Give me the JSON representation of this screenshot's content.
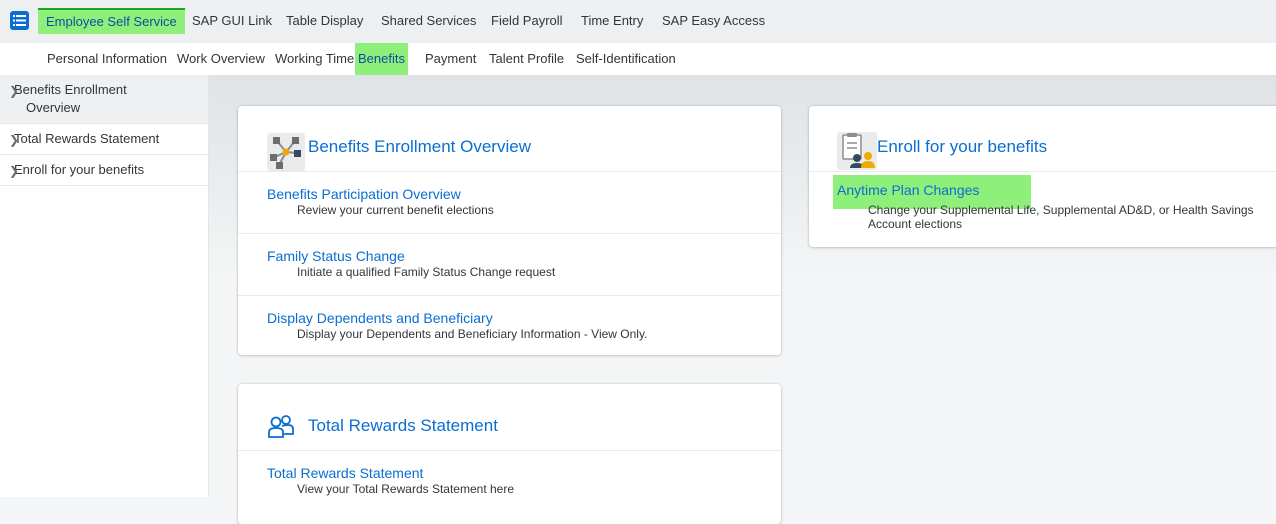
{
  "top_tabs": [
    "Employee Self Service",
    "SAP GUI Link",
    "Table Display",
    "Shared Services",
    "Field Payroll",
    "Time Entry",
    "SAP Easy Access"
  ],
  "sub_tabs": [
    "Personal Information",
    "Work Overview",
    "Working Time",
    "Benefits",
    "Payment",
    "Talent Profile",
    "Self-Identification"
  ],
  "sidebar": {
    "items": [
      {
        "label_line1": "Benefits Enrollment",
        "label_line2": "Overview"
      },
      {
        "label": "Total Rewards Statement"
      },
      {
        "label": "Enroll for your benefits"
      }
    ]
  },
  "cards": {
    "benefits_overview": {
      "title": "Benefits Enrollment Overview",
      "links": [
        {
          "title": "Benefits Participation Overview",
          "desc": "Review your current benefit elections"
        },
        {
          "title": "Family Status Change",
          "desc": "Initiate a qualified Family Status Change request"
        },
        {
          "title": "Display Dependents and Beneficiary",
          "desc": "Display your Dependents and Beneficiary Information - View Only."
        }
      ]
    },
    "total_rewards": {
      "title": "Total Rewards Statement",
      "links": [
        {
          "title": "Total Rewards Statement",
          "desc": "View your Total Rewards Statement here"
        }
      ]
    },
    "enroll": {
      "title": "Enroll for your benefits",
      "links": [
        {
          "title": "Anytime Plan Changes",
          "desc_line1": "Change your Supplemental Life, Supplemental AD&D, or Health Savings",
          "desc_line2": "Account elections"
        }
      ]
    }
  },
  "colors": {
    "accent": "#0a6ed1",
    "highlight": "#8ef07a"
  },
  "icons": [
    "menu-icon",
    "network-icon",
    "people-icon",
    "form-person-icon",
    "chevron-right-icon"
  ]
}
